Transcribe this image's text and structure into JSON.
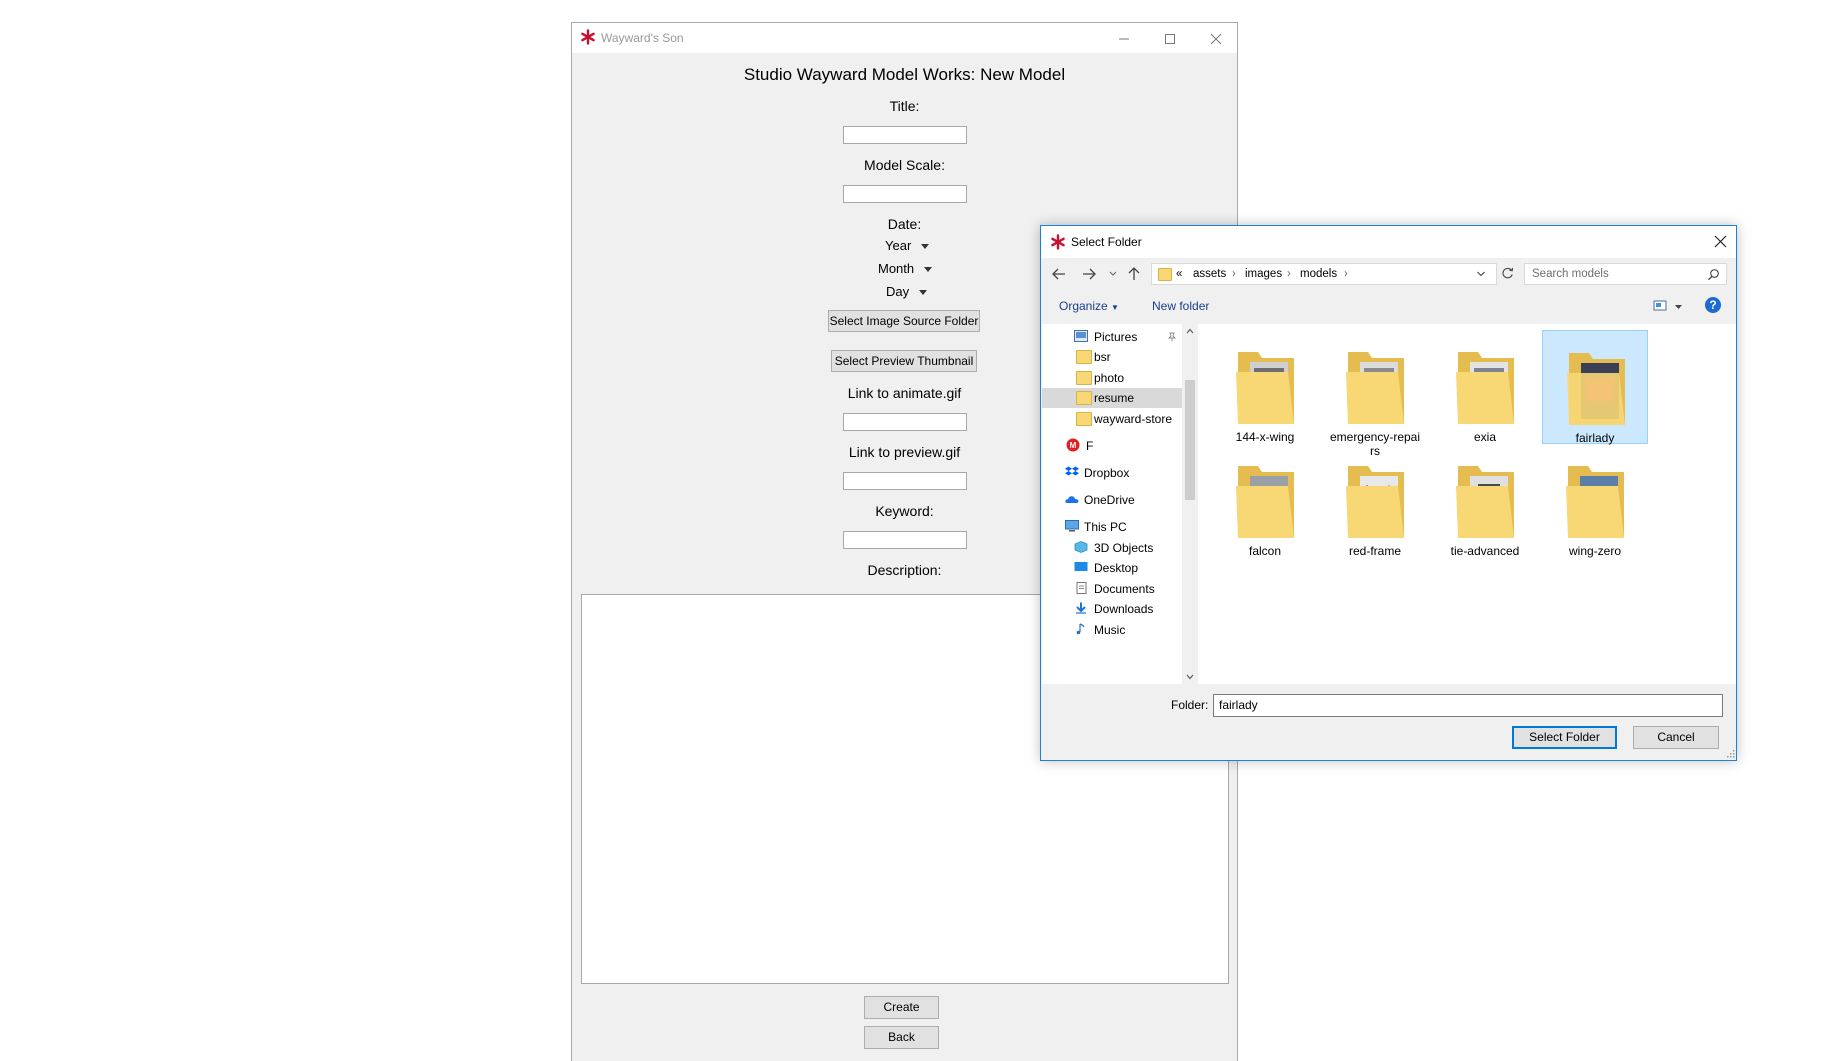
{
  "main_window": {
    "title": "Wayward's Son",
    "heading": "Studio Wayward Model Works: New Model",
    "title_label": "Title:",
    "title_value": "",
    "scale_label": "Model Scale:",
    "scale_value": "",
    "date_label": "Date:",
    "year": "Year",
    "month": "Month",
    "day": "Day",
    "select_source_button": "Select Image Source Folder",
    "select_thumbnail_button": "Select Preview Thumbnail",
    "animate_label": "Link to animate.gif",
    "animate_value": "",
    "preview_label": "Link to preview.gif",
    "preview_value": "",
    "keyword_label": "Keyword:",
    "keyword_value": "",
    "description_label": "Description:",
    "description_value": "",
    "create_button": "Create",
    "back_button": "Back"
  },
  "dialog": {
    "title": "Select Folder",
    "breadcrumb": [
      "«",
      "assets",
      "images",
      "models"
    ],
    "search_placeholder": "Search models",
    "organize": "Organize",
    "new_folder": "New folder",
    "nav_items": [
      {
        "label": "Pictures",
        "icon": "pictures-icon"
      },
      {
        "label": "bsr",
        "icon": "folder-icon"
      },
      {
        "label": "photo",
        "icon": "folder-icon"
      },
      {
        "label": "resume",
        "icon": "folder-icon",
        "selected": true
      },
      {
        "label": "wayward-store",
        "icon": "folder-icon"
      },
      {
        "label": "F",
        "icon": "drive-f-icon"
      },
      {
        "label": "Dropbox",
        "icon": "dropbox-icon"
      },
      {
        "label": "OneDrive",
        "icon": "onedrive-icon"
      },
      {
        "label": "This PC",
        "icon": "this-pc-icon"
      },
      {
        "label": "3D Objects",
        "icon": "3d-objects-icon"
      },
      {
        "label": "Desktop",
        "icon": "desktop-icon"
      },
      {
        "label": "Documents",
        "icon": "documents-icon"
      },
      {
        "label": "Downloads",
        "icon": "downloads-icon"
      },
      {
        "label": "Music",
        "icon": "music-icon"
      }
    ],
    "folders": [
      {
        "name": "144-x-wing"
      },
      {
        "name": "emergency-repairs",
        "line1": "emergency-repai",
        "line2": "rs"
      },
      {
        "name": "exia"
      },
      {
        "name": "fairlady",
        "selected": true
      },
      {
        "name": "falcon"
      },
      {
        "name": "red-frame"
      },
      {
        "name": "tie-advanced"
      },
      {
        "name": "wing-zero"
      }
    ],
    "folder_label": "Folder:",
    "folder_value": "fairlady",
    "select_button": "Select Folder",
    "cancel_button": "Cancel"
  },
  "colors": {
    "accent": "#1883d7",
    "selection": "#cce8ff",
    "window_bg": "#f0f0f0",
    "folder": "#f8d775",
    "app_icon": "#c8102e"
  }
}
